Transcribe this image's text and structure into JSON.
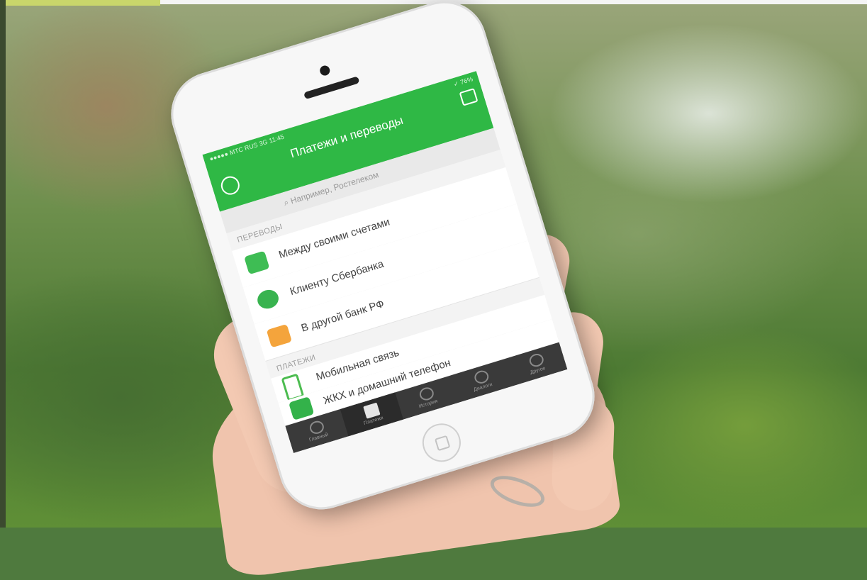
{
  "app": {
    "title": "Платежи и переводы",
    "status_left": "●●●●● МТС RUS  3G  11:45",
    "status_right": "✓ 76%",
    "search_placeholder": "Например, Ростелеком"
  },
  "sections": [
    {
      "label": "ПЕРЕВОДЫ",
      "items": [
        {
          "label": "Между своими счетами",
          "icon": "cards-icon"
        },
        {
          "label": "Клиенту Сбербанка",
          "icon": "client-icon"
        },
        {
          "label": "В другой банк РФ",
          "icon": "bank-icon"
        }
      ]
    },
    {
      "label": "ПЛАТЕЖИ",
      "items": [
        {
          "label": "Мобильная связь",
          "icon": "mobile-icon"
        },
        {
          "label": "ЖКХ и домашний телефон",
          "icon": "house-icon"
        }
      ]
    }
  ],
  "tabbar": [
    {
      "label": "Главный",
      "icon": "home-icon"
    },
    {
      "label": "Платежи",
      "icon": "payments-icon",
      "active": true
    },
    {
      "label": "История",
      "icon": "history-icon"
    },
    {
      "label": "Диалоги",
      "icon": "chat-icon"
    },
    {
      "label": "Другое",
      "icon": "other-icon"
    }
  ],
  "colors": {
    "accent": "#2fb845"
  }
}
